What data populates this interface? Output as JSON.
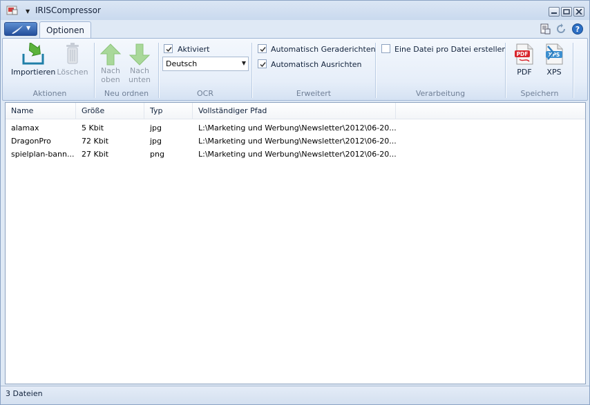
{
  "window": {
    "title": "IRISCompressor"
  },
  "tabs": [
    {
      "label": "Optionen"
    }
  ],
  "ribbon": {
    "aktionen": {
      "label": "Aktionen",
      "import_label": "Importieren",
      "delete_label": "Löschen"
    },
    "neu_ordnen": {
      "label": "Neu ordnen",
      "up_label_1": "Nach",
      "up_label_2": "oben",
      "down_label_1": "Nach",
      "down_label_2": "unten"
    },
    "ocr": {
      "label": "OCR",
      "activated_label": "Aktiviert",
      "activated_checked": true,
      "language": "Deutsch"
    },
    "erweitert": {
      "label": "Erweitert",
      "straighten_label": "Automatisch Geraderichten",
      "straighten_checked": true,
      "align_label": "Automatisch Ausrichten",
      "align_checked": true
    },
    "verarbeitung": {
      "label": "Verarbeitung",
      "one_file_label": "Eine Datei pro Datei erstellen",
      "one_file_checked": false
    },
    "speichern": {
      "label": "Speichern",
      "pdf_label": "PDF",
      "xps_label": "XPS"
    }
  },
  "table": {
    "columns": [
      "Name",
      "Größe",
      "Typ",
      "Vollständiger Pfad"
    ],
    "rows": [
      {
        "name": "alamax",
        "size": "5 Kbit",
        "type": "jpg",
        "path": "L:\\Marketing und Werbung\\Newsletter\\2012\\06-20..."
      },
      {
        "name": "DragonPro",
        "size": "72 Kbit",
        "type": "jpg",
        "path": "L:\\Marketing und Werbung\\Newsletter\\2012\\06-20..."
      },
      {
        "name": "spielplan-bann...",
        "size": "27 Kbit",
        "type": "png",
        "path": "L:\\Marketing und Werbung\\Newsletter\\2012\\06-20..."
      }
    ]
  },
  "status": {
    "text": "3 Dateien"
  },
  "icons": {
    "app": "app-icon",
    "import": "import-icon",
    "delete": "trash-icon",
    "move_up": "arrow-up-icon",
    "move_down": "arrow-down-icon",
    "pdf": "pdf-file-icon",
    "xps": "xps-file-icon",
    "help": "help-icon"
  }
}
